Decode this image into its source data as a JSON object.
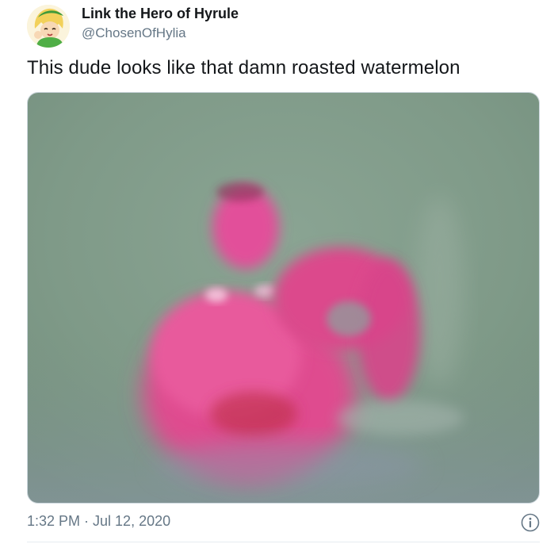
{
  "tweet": {
    "display_name": "Link the Hero of Hyrule",
    "handle": "@ChosenOfHylia",
    "text": "This dude looks like that damn roasted watermelon",
    "timestamp": "1:32 PM · Jul 12, 2020"
  },
  "icons": {
    "avatar": "cartoon-avatar",
    "info": "info-icon"
  },
  "colors": {
    "text_primary": "#14171a",
    "text_secondary": "#657786",
    "media_background": "#7f9a88",
    "subject_pink": "#e64f96"
  }
}
